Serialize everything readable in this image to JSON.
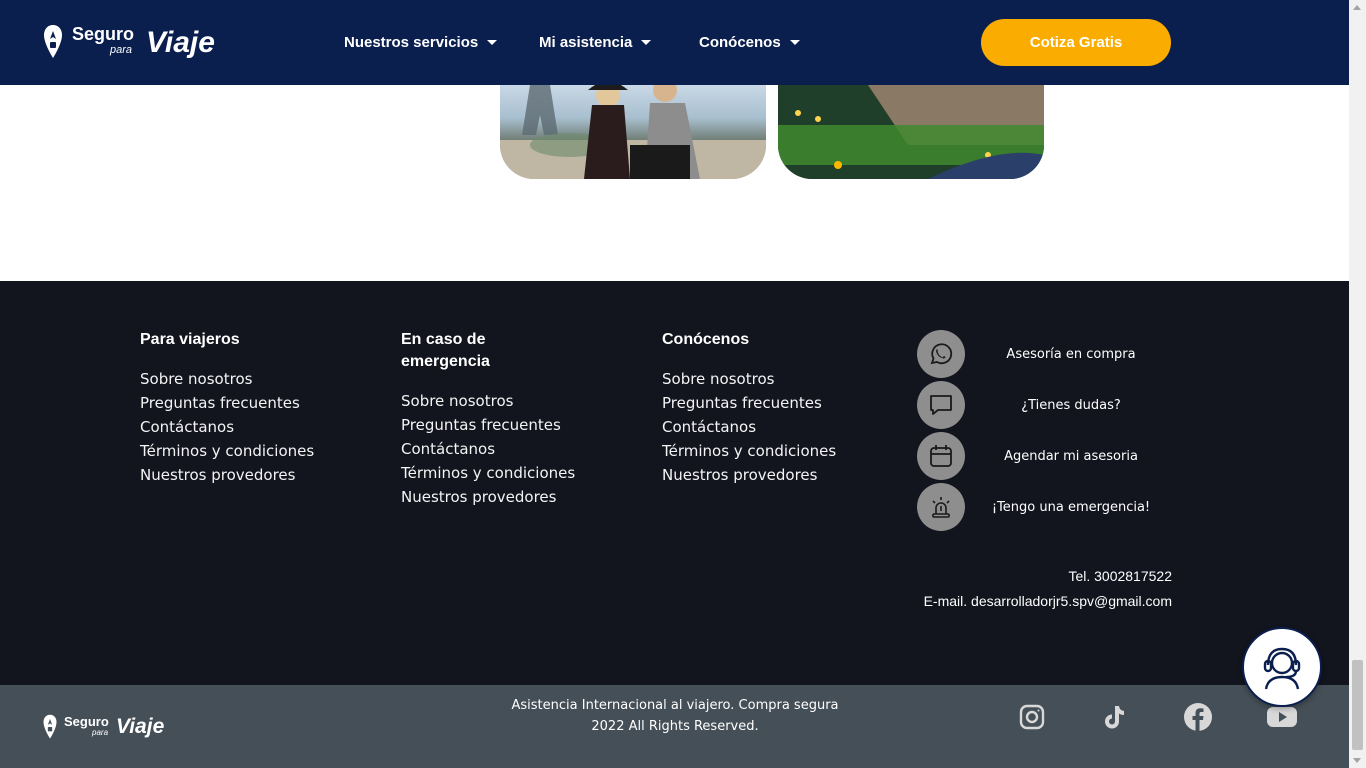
{
  "header": {
    "logo": {
      "word1": "Seguro",
      "word2": "para",
      "word3": "Viaje",
      "icon": "travel-pin-icon"
    },
    "nav": [
      {
        "label": "Nuestros servicios"
      },
      {
        "label": "Mi asistencia"
      },
      {
        "label": "Conócenos"
      }
    ],
    "cta_label": "Cotiza Gratis",
    "cta_color": "#fbac00",
    "background": "#0b1f4e"
  },
  "gallery": {
    "images": [
      {
        "name": "paris-couple-photo"
      },
      {
        "name": "fortress-night-photo"
      }
    ]
  },
  "footer": {
    "background": "#12141e",
    "columns": [
      {
        "title": "Para viajeros",
        "links": [
          "Sobre nosotros",
          "Preguntas frecuentes",
          "Contáctanos",
          "Términos y condiciones",
          "Nuestros provedores"
        ]
      },
      {
        "title": "En caso de emergencia",
        "links": [
          "Sobre nosotros",
          "Preguntas frecuentes",
          "Contáctanos",
          "Términos y condiciones",
          "Nuestros provedores"
        ]
      },
      {
        "title": "Conócenos",
        "links": [
          "Sobre nosotros",
          "Preguntas frecuentes",
          "Contáctanos",
          "Términos y condiciones",
          "Nuestros provedores"
        ]
      }
    ],
    "contact": [
      {
        "label": "Asesoría en compra",
        "icon": "whatsapp-icon"
      },
      {
        "label": "¿Tienes dudas?",
        "icon": "chat-bubble-icon"
      },
      {
        "label": "Agendar mi asesoria",
        "icon": "calendar-icon"
      },
      {
        "label": "¡Tengo una emergencia!",
        "icon": "siren-icon"
      }
    ],
    "tel": "Tel. 3002817522",
    "email": "E-mail. desarrolladorjr5.spv@gmail.com"
  },
  "bottom_bar": {
    "background": "#454f57",
    "logo": {
      "word1": "Seguro",
      "word2": "para",
      "word3": "Viaje"
    },
    "copyright_line1": "Asistencia Internacional al viajero. Compra segura",
    "copyright_line2": "2022 All Rights Reserved.",
    "social": [
      "instagram-icon",
      "tiktok-icon",
      "facebook-icon",
      "youtube-icon"
    ]
  },
  "chat_widget": {
    "icon": "support-agent-icon"
  }
}
